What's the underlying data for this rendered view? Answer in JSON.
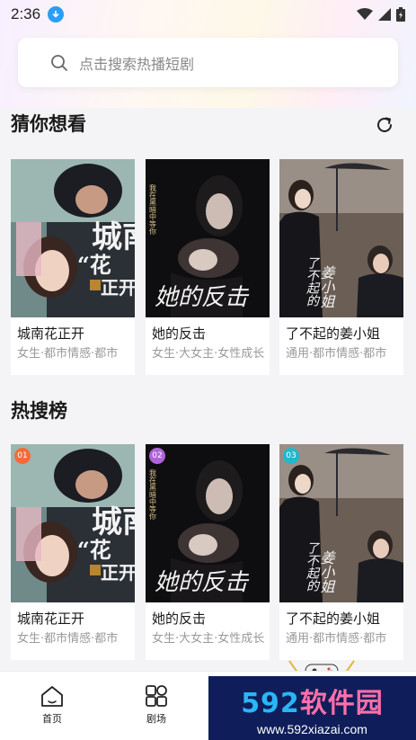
{
  "status_bar": {
    "time": "2:36"
  },
  "search": {
    "placeholder": "点击搜索热播短剧"
  },
  "sections": {
    "recommend": {
      "title": "猜你想看",
      "items": [
        {
          "title": "城南花正开",
          "tags": "女生·都市情感·都市"
        },
        {
          "title": "她的反击",
          "tags": "女生·大女主·女性成长"
        },
        {
          "title": "了不起的姜小姐",
          "tags": "通用·都市情感·都市"
        }
      ]
    },
    "hot": {
      "title": "热搜榜",
      "items": [
        {
          "rank": "01",
          "rank_color": "#f26b3a",
          "title": "城南花正开",
          "tags": "女生·都市情感·都市"
        },
        {
          "rank": "02",
          "rank_color": "#b063d9",
          "title": "她的反击",
          "tags": "女生·大女主·女性成长"
        },
        {
          "rank": "03",
          "rank_color": "#21b8c9",
          "title": "了不起的姜小姐",
          "tags": "通用·都市情感·都市"
        }
      ]
    }
  },
  "posters": {
    "p1": {
      "big": "城南",
      "quote": "“花",
      "small": "正开"
    },
    "p2": {
      "vertical": "我在黑暗中等你",
      "script": "她的反击"
    },
    "p3": {
      "script1": "了不起的",
      "script2": "姜小姐"
    }
  },
  "tabbar": {
    "items": [
      {
        "label": "首页",
        "icon": "home-icon"
      },
      {
        "label": "剧场",
        "icon": "theater-icon"
      }
    ]
  },
  "watermark": {
    "num": "592",
    "cn": "软件园",
    "url": "www.592xiazai.com"
  },
  "colors": {
    "accent_blue": "#2a9df4",
    "watermark_bg": "#0f1e5a"
  }
}
